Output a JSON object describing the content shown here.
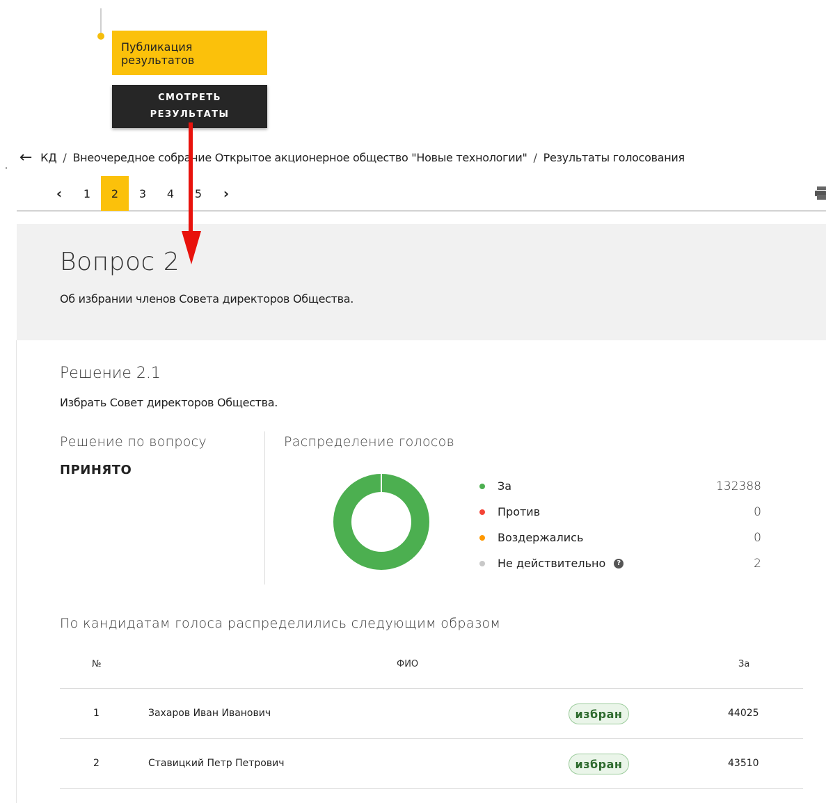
{
  "timeline": {
    "stage_label": "Публикация результатов",
    "view_button_line1": "СМОТРЕТЬ",
    "view_button_line2": "РЕЗУЛЬТАТЫ"
  },
  "breadcrumb": {
    "back_icon": "arrow-left-icon",
    "items": [
      "КД",
      "Внеочередное собрание Открытое акционерное общество \"Новые технологии\"",
      "Результаты голосования"
    ]
  },
  "pager": {
    "pages": [
      "1",
      "2",
      "3",
      "4",
      "5"
    ],
    "active_page": "2"
  },
  "question": {
    "title": "Вопрос 2",
    "description": "Об избрании членов Совета директоров Общества."
  },
  "decision": {
    "title": "Решение 2.1",
    "description": "Избрать Совет директоров Общества.",
    "result_label": "Решение по вопросу",
    "result_value": "ПРИНЯТО"
  },
  "distribution": {
    "title": "Распределение голосов",
    "legend": [
      {
        "label": "За",
        "value": "132388",
        "color": "#4caf50"
      },
      {
        "label": "Против",
        "value": "0",
        "color": "#f44336"
      },
      {
        "label": "Воздержались",
        "value": "0",
        "color": "#ff9800"
      },
      {
        "label": "Не действительно",
        "value": "2",
        "color": "#c8c8c8"
      }
    ]
  },
  "candidates": {
    "title": "По кандидатам голоса распределились следующим образом",
    "headers": {
      "num": "№",
      "name": "ФИО",
      "votes": "За"
    },
    "rows": [
      {
        "num": "1",
        "name": "Захаров Иван Иванович",
        "status": "избран",
        "votes": "44025"
      },
      {
        "num": "2",
        "name": "Ставицкий Петр Петрович",
        "status": "избран",
        "votes": "43510"
      }
    ]
  },
  "colors": {
    "accent": "#fbc10b",
    "dark_button": "#262626",
    "annotation_arrow": "#e8120c",
    "elected_badge": "#2e6b2e"
  }
}
